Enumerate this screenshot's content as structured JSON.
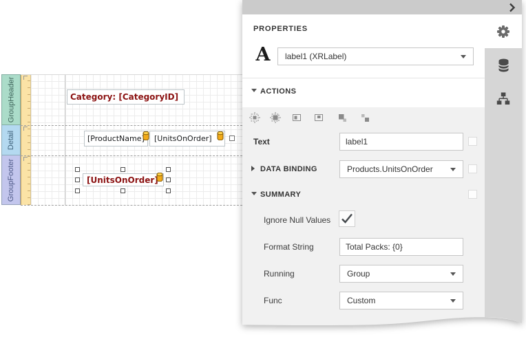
{
  "design_surface": {
    "bands": [
      {
        "label": "GroupHeader",
        "color": "#abdcc9"
      },
      {
        "label": "Detail",
        "color": "#b4d9f0"
      },
      {
        "label": "GroupFooter",
        "color": "#c3c6ed"
      }
    ],
    "controls": [
      {
        "name": "category-label",
        "text": "Category: [CategoryID]",
        "band": "GroupHeader",
        "data_bound": false,
        "emphasized": true
      },
      {
        "name": "product-name-label",
        "text": "[ProductName]",
        "band": "Detail",
        "data_bound": true
      },
      {
        "name": "units-on-order-label",
        "text": "[UnitsOnOrder]",
        "band": "Detail",
        "data_bound": true
      },
      {
        "name": "footer-summary-label",
        "text": "[UnitsOnOrder]",
        "band": "GroupFooter",
        "data_bound": true,
        "selected": true,
        "emphasized": true
      }
    ],
    "accent_text_color": "#8b1212",
    "ruler_color": "#fbe3a6"
  },
  "properties_panel": {
    "title": "PROPERTIES",
    "collapse_icon": "chevron-right-icon",
    "selected_element": {
      "icon": "xrlabel-letter-a-icon",
      "value": "label1 (XRLabel)"
    },
    "sections": {
      "actions": {
        "title": "ACTIONS",
        "expanded": true
      },
      "data_binding": {
        "title": "DATA BINDING",
        "expanded": false,
        "value": "Products.UnitsOnOrder"
      },
      "summary": {
        "title": "SUMMARY",
        "expanded": true
      }
    },
    "action_icons": [
      "fit-to-band-width-icon",
      "fit-bounds-to-container-icon",
      "center-horizontally-icon",
      "center-vertically-icon",
      "bring-to-front-icon",
      "send-to-back-icon"
    ],
    "fields": {
      "text": {
        "label": "Text",
        "value": "label1"
      },
      "ignore_null_values": {
        "label": "Ignore Null Values",
        "checked": true
      },
      "format_string": {
        "label": "Format String",
        "value": "Total Packs: {0}"
      },
      "running": {
        "label": "Running",
        "value": "Group"
      },
      "func": {
        "label": "Func",
        "value": "Custom"
      }
    },
    "side_tabs": [
      "properties-gear-icon",
      "data-sources-icon",
      "field-list-icon"
    ],
    "colors": {
      "topbar": "#cbcbcb",
      "body_gray": "#f1f1f1",
      "tab_strip": "#d6d6d6"
    }
  }
}
